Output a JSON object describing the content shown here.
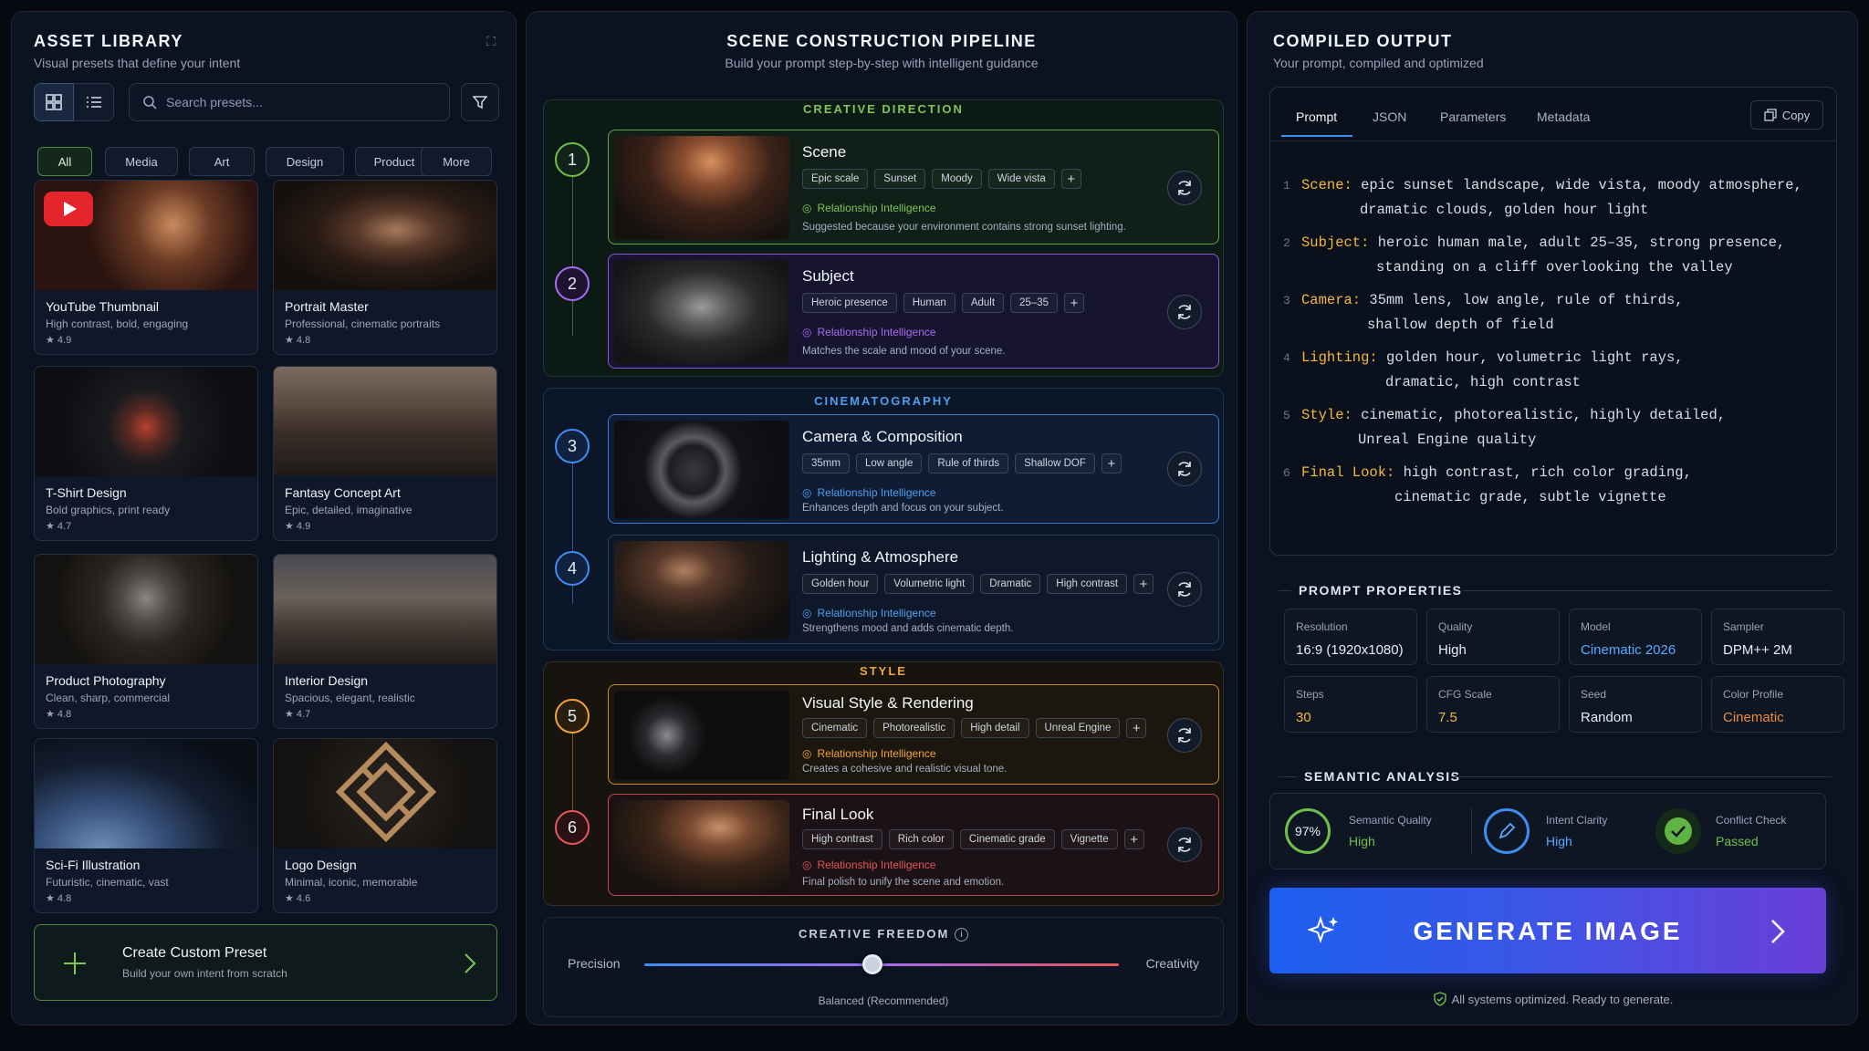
{
  "left": {
    "title": "ASSET LIBRARY",
    "subtitle": "Visual presets that define your intent",
    "search_placeholder": "Search presets...",
    "filters": [
      "All",
      "Media",
      "Art",
      "Design",
      "Product",
      "More"
    ],
    "presets": [
      {
        "title": "YouTube Thumbnail",
        "desc": "High contrast, bold, engaging",
        "rating": "★ 4.9"
      },
      {
        "title": "Portrait Master",
        "desc": "Professional, cinematic portraits",
        "rating": "★ 4.8"
      },
      {
        "title": "T-Shirt Design",
        "desc": "Bold graphics, print ready",
        "rating": "★ 4.7"
      },
      {
        "title": "Fantasy Concept Art",
        "desc": "Epic, detailed, imaginative",
        "rating": "★ 4.9"
      },
      {
        "title": "Product Photography",
        "desc": "Clean, sharp, commercial",
        "rating": "★ 4.8"
      },
      {
        "title": "Interior Design",
        "desc": "Spacious, elegant, realistic",
        "rating": "★ 4.7"
      },
      {
        "title": "Sci-Fi Illustration",
        "desc": "Futuristic, cinematic, vast",
        "rating": "★ 4.8"
      },
      {
        "title": "Logo Design",
        "desc": "Minimal, iconic, memorable",
        "rating": "★ 4.6"
      }
    ],
    "custom": {
      "title": "Create Custom Preset",
      "desc": "Build your own intent from scratch"
    }
  },
  "mid": {
    "title": "SCENE CONSTRUCTION PIPELINE",
    "subtitle": "Build your prompt step-by-step with intelligent guidance",
    "groups": [
      "CREATIVE DIRECTION",
      "CINEMATOGRAPHY",
      "STYLE"
    ],
    "ri_label": "Relationship Intelligence",
    "steps": [
      {
        "num": "1",
        "name": "Scene",
        "tags": [
          "Epic scale",
          "Sunset",
          "Moody",
          "Wide vista"
        ],
        "desc": "Suggested because your environment contains strong sunset lighting."
      },
      {
        "num": "2",
        "name": "Subject",
        "tags": [
          "Heroic presence",
          "Human",
          "Adult",
          "25–35"
        ],
        "desc": "Matches the scale and mood of your scene."
      },
      {
        "num": "3",
        "name": "Camera & Composition",
        "tags": [
          "35mm",
          "Low angle",
          "Rule of thirds",
          "Shallow DOF"
        ],
        "desc": "Enhances depth and focus on your subject."
      },
      {
        "num": "4",
        "name": "Lighting & Atmosphere",
        "tags": [
          "Golden hour",
          "Volumetric light",
          "Dramatic",
          "High contrast"
        ],
        "desc": "Strengthens mood and adds cinematic depth."
      },
      {
        "num": "5",
        "name": "Visual Style & Rendering",
        "tags": [
          "Cinematic",
          "Photorealistic",
          "High detail",
          "Unreal Engine"
        ],
        "desc": "Creates a cohesive and realistic visual tone."
      },
      {
        "num": "6",
        "name": "Final Look",
        "tags": [
          "High contrast",
          "Rich color",
          "Cinematic grade",
          "Vignette"
        ],
        "desc": "Final polish to unify the scene and emotion."
      }
    ],
    "freedom": {
      "title": "CREATIVE FREEDOM",
      "left": "Precision",
      "right": "Creativity",
      "value_label": "Balanced (Recommended)",
      "value": 0.48
    }
  },
  "right": {
    "title": "COMPILED OUTPUT",
    "subtitle": "Your prompt, compiled and optimized",
    "tabs": [
      "Prompt",
      "JSON",
      "Parameters",
      "Metadata"
    ],
    "copy": "Copy",
    "prompt_lines": [
      {
        "n": "1",
        "key": "Scene:",
        "l1": " epic sunset landscape, wide vista, moody atmosphere,",
        "l2": "dramatic clouds, golden hour light"
      },
      {
        "n": "2",
        "key": "Subject:",
        "l1": " heroic human male, adult 25–35, strong presence,",
        "l2": "standing on a cliff overlooking the valley"
      },
      {
        "n": "3",
        "key": "Camera:",
        "l1": " 35mm lens, low angle, rule of thirds,",
        "l2": "shallow depth of field"
      },
      {
        "n": "4",
        "key": "Lighting:",
        "l1": " golden hour, volumetric light rays,",
        "l2": "dramatic, high contrast"
      },
      {
        "n": "5",
        "key": "Style:",
        "l1": " cinematic, photorealistic, highly detailed,",
        "l2": "Unreal Engine quality"
      },
      {
        "n": "6",
        "key": "Final Look:",
        "l1": " high contrast, rich color grading,",
        "l2": "cinematic grade, subtle vignette"
      }
    ],
    "props_title": "PROMPT PROPERTIES",
    "props": [
      {
        "label": "Resolution",
        "value": "16:9 (1920x1080)",
        "color": "#e6edf5"
      },
      {
        "label": "Quality",
        "value": "High",
        "color": "#e6edf5"
      },
      {
        "label": "Model",
        "value": "Cinematic 2026",
        "color": "#5aa9ff"
      },
      {
        "label": "Sampler",
        "value": "DPM++ 2M",
        "color": "#e6edf5"
      },
      {
        "label": "Steps",
        "value": "30",
        "color": "#f5b73b"
      },
      {
        "label": "CFG Scale",
        "value": "7.5",
        "color": "#f5b73b"
      },
      {
        "label": "Seed",
        "value": "Random",
        "color": "#e6edf5"
      },
      {
        "label": "Color Profile",
        "value": "Cinematic",
        "color": "#f08a3a"
      }
    ],
    "semantic_title": "SEMANTIC ANALYSIS",
    "semantic": [
      {
        "label": "Semantic Quality",
        "value": "High",
        "badge": "97%"
      },
      {
        "label": "Intent Clarity",
        "value": "High"
      },
      {
        "label": "Conflict Check",
        "value": "Passed"
      }
    ],
    "generate": "GENERATE IMAGE",
    "status": "All systems optimized. Ready to generate."
  },
  "colors": {
    "green": "#6fbf4a",
    "purple": "#a76cf0",
    "blue": "#3f8df0",
    "orange": "#f0a43a",
    "red": "#e4575a"
  }
}
